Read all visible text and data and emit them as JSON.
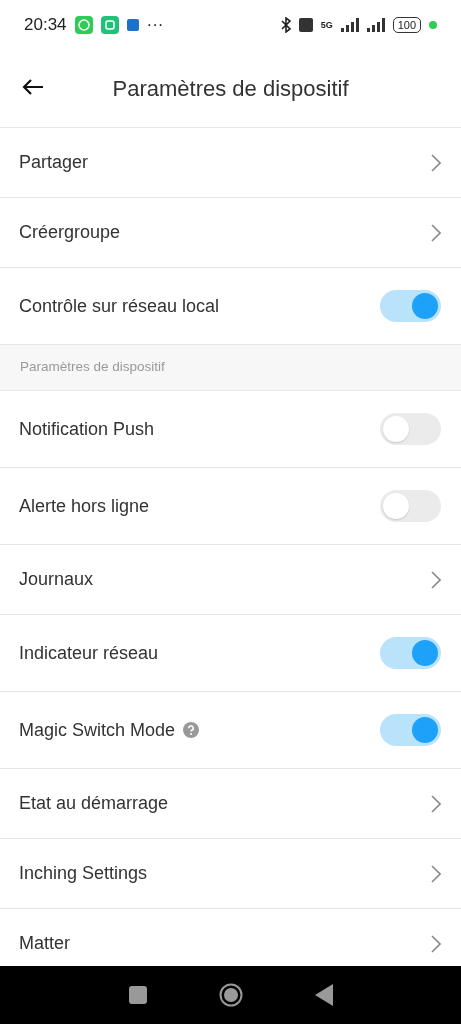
{
  "status_bar": {
    "time": "20:34",
    "more": "···",
    "network": "5G",
    "battery": "100"
  },
  "header": {
    "title": "Paramètres de dispositif"
  },
  "groups": [
    {
      "rows": [
        {
          "kind": "link",
          "label": "Partager"
        },
        {
          "kind": "link",
          "label": "Créergroupe"
        },
        {
          "kind": "toggle",
          "label": "Contrôle sur réseau local",
          "on": true
        }
      ]
    },
    {
      "heading": "Paramètres de dispositif",
      "rows": [
        {
          "kind": "toggle",
          "label": "Notification Push",
          "on": false
        },
        {
          "kind": "toggle",
          "label": "Alerte hors ligne",
          "on": false
        },
        {
          "kind": "link",
          "label": "Journaux"
        },
        {
          "kind": "toggle",
          "label": "Indicateur réseau",
          "on": true
        },
        {
          "kind": "toggle",
          "label": "Magic Switch Mode",
          "on": true,
          "help": true
        },
        {
          "kind": "link",
          "label": "Etat au démarrage"
        },
        {
          "kind": "link",
          "label": "Inching Settings"
        },
        {
          "kind": "link",
          "label": "Matter"
        }
      ]
    }
  ]
}
